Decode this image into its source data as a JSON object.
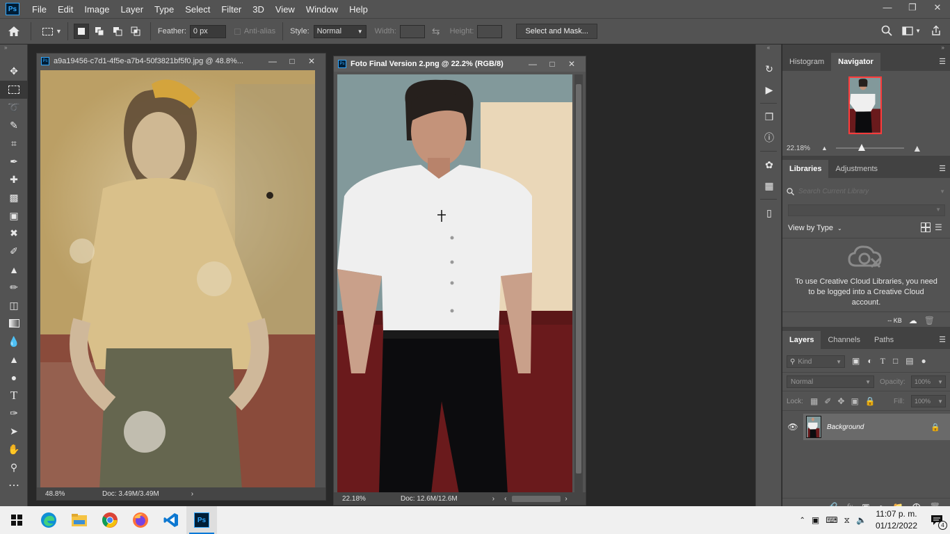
{
  "menubar": {
    "logo": "Ps",
    "items": [
      "File",
      "Edit",
      "Image",
      "Layer",
      "Type",
      "Select",
      "Filter",
      "3D",
      "View",
      "Window",
      "Help"
    ]
  },
  "options": {
    "feather_label": "Feather:",
    "feather_value": "0 px",
    "antialias_label": "Anti-alias",
    "style_label": "Style:",
    "style_value": "Normal",
    "width_label": "Width:",
    "height_label": "Height:",
    "select_mask_label": "Select and Mask..."
  },
  "doc1": {
    "title": "a9a19456-c7d1-4f5e-a7b4-50f3821bf5f0.jpg @ 48.8%...",
    "zoom": "48.8%",
    "info": "Doc: 3.49M/3.49M"
  },
  "doc2": {
    "title": "Foto Final Version 2.png @ 22.2% (RGB/8)",
    "zoom": "22.18%",
    "info": "Doc: 12.6M/12.6M"
  },
  "navigator": {
    "tabs": [
      "Histogram",
      "Navigator"
    ],
    "zoom": "22.18%"
  },
  "libraries": {
    "tabs": [
      "Libraries",
      "Adjustments"
    ],
    "search_placeholder": "Search Current Library",
    "view_by": "View by Type",
    "message": "To use Creative Cloud Libraries, you need to be logged into a Creative Cloud account.",
    "size": "-- KB"
  },
  "layers": {
    "tabs": [
      "Layers",
      "Channels",
      "Paths"
    ],
    "kind_label": "Kind",
    "blend_mode": "Normal",
    "opacity_label": "Opacity:",
    "opacity_value": "100%",
    "lock_label": "Lock:",
    "fill_label": "Fill:",
    "fill_value": "100%",
    "layer_name": "Background"
  },
  "taskbar": {
    "time": "11:07 p. m.",
    "date": "01/12/2022",
    "notifications": "4"
  },
  "colors": {
    "ps_blue": "#31a8ff",
    "panel_bg": "#535353",
    "canvas_bg": "#282828"
  }
}
